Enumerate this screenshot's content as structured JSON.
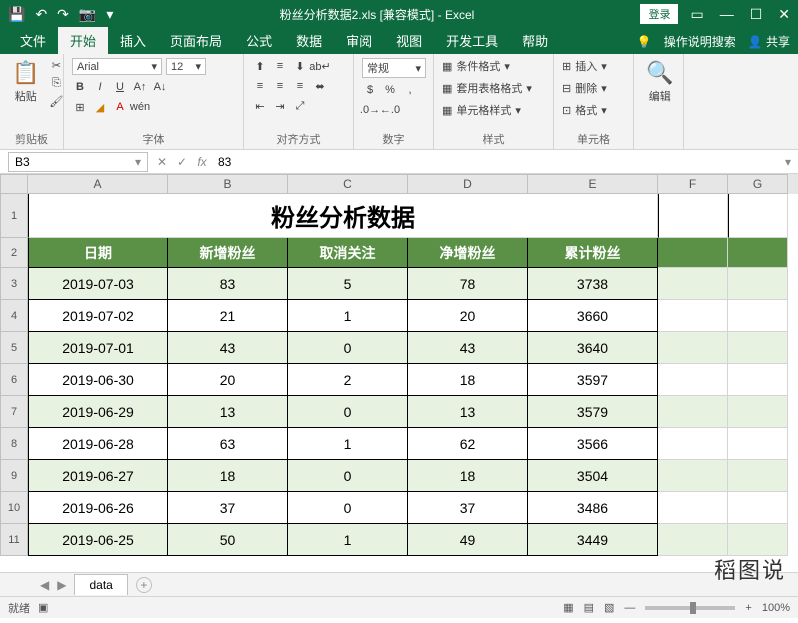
{
  "titlebar": {
    "filename": "粉丝分析数据2.xls",
    "mode": "[兼容模式]",
    "app": "Excel",
    "login": "登录"
  },
  "tabs": {
    "file": "文件",
    "home": "开始",
    "insert": "插入",
    "layout": "页面布局",
    "formula": "公式",
    "data": "数据",
    "review": "审阅",
    "view": "视图",
    "dev": "开发工具",
    "help": "帮助",
    "tell": "操作说明搜索",
    "share": "共享"
  },
  "ribbon": {
    "clipboard": {
      "label": "剪贴板",
      "paste": "粘贴"
    },
    "font": {
      "label": "字体",
      "name": "Arial",
      "size": "12"
    },
    "align": {
      "label": "对齐方式"
    },
    "number": {
      "label": "数字",
      "format": "常规"
    },
    "styles": {
      "label": "样式",
      "cond": "条件格式",
      "table": "套用表格格式",
      "cell": "单元格样式"
    },
    "cells": {
      "label": "单元格",
      "insert": "插入",
      "delete": "删除",
      "format": "格式"
    },
    "editing": {
      "label": "编辑"
    }
  },
  "formula": {
    "cell": "B3",
    "value": "83"
  },
  "sheet": {
    "cols": [
      "A",
      "B",
      "C",
      "D",
      "E",
      "F",
      "G"
    ],
    "title": "粉丝分析数据",
    "headers": [
      "日期",
      "新增粉丝",
      "取消关注",
      "净增粉丝",
      "累计粉丝"
    ],
    "rows": [
      {
        "d": "2019-07-03",
        "a": "83",
        "b": "5",
        "c": "78",
        "e": "3738"
      },
      {
        "d": "2019-07-02",
        "a": "21",
        "b": "1",
        "c": "20",
        "e": "3660"
      },
      {
        "d": "2019-07-01",
        "a": "43",
        "b": "0",
        "c": "43",
        "e": "3640"
      },
      {
        "d": "2019-06-30",
        "a": "20",
        "b": "2",
        "c": "18",
        "e": "3597"
      },
      {
        "d": "2019-06-29",
        "a": "13",
        "b": "0",
        "c": "13",
        "e": "3579"
      },
      {
        "d": "2019-06-28",
        "a": "63",
        "b": "1",
        "c": "62",
        "e": "3566"
      },
      {
        "d": "2019-06-27",
        "a": "18",
        "b": "0",
        "c": "18",
        "e": "3504"
      },
      {
        "d": "2019-06-26",
        "a": "37",
        "b": "0",
        "c": "37",
        "e": "3486"
      },
      {
        "d": "2019-06-25",
        "a": "50",
        "b": "1",
        "c": "49",
        "e": "3449"
      }
    ],
    "tab": "data"
  },
  "status": {
    "ready": "就绪",
    "zoom": "100%"
  },
  "watermark": "稻图说"
}
